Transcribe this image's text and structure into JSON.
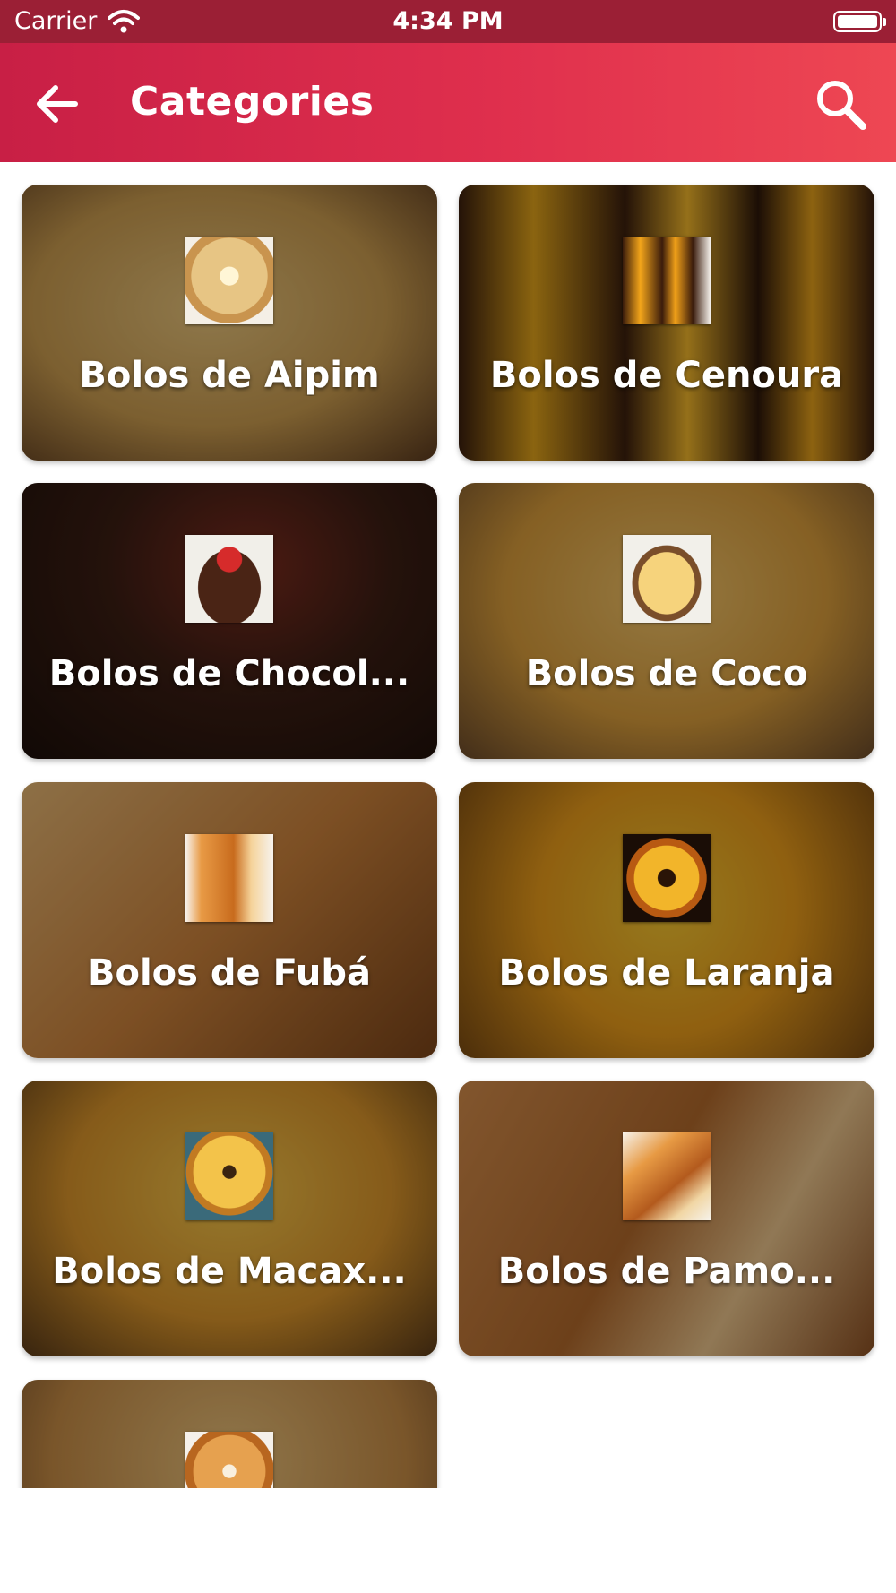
{
  "status_bar": {
    "carrier": "Carrier",
    "time": "4:34 PM",
    "icons": [
      "wifi-icon",
      "battery-icon"
    ]
  },
  "app_bar": {
    "title": "Categories",
    "back_icon": "arrow-left-icon",
    "search_icon": "search-icon",
    "gradient": [
      "#c81f45",
      "#ee4753"
    ]
  },
  "categories": [
    {
      "label": "Bolos de Aipim"
    },
    {
      "label": "Bolos de Cenoura"
    },
    {
      "label": "Bolos de Chocol..."
    },
    {
      "label": "Bolos de Coco"
    },
    {
      "label": "Bolos de Fubá"
    },
    {
      "label": "Bolos de Laranja"
    },
    {
      "label": "Bolos de Macax..."
    },
    {
      "label": "Bolos de Pamo..."
    },
    {
      "label": ""
    }
  ]
}
